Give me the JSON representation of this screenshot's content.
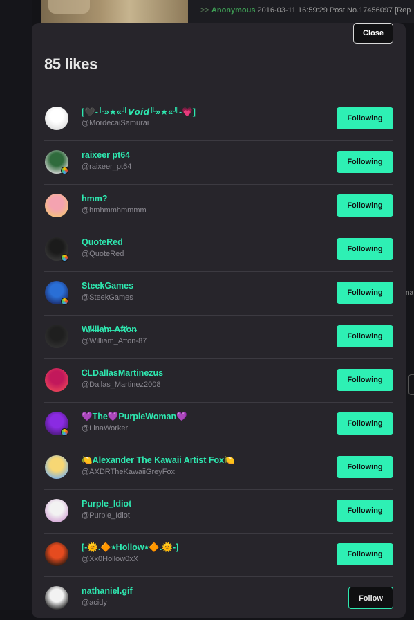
{
  "background": {
    "post_quote": ">>",
    "post_name": "Anonymous",
    "post_meta": "2016-03-11 16:59:29 Post No.17456097 [Rep"
  },
  "modal": {
    "title": "85 likes",
    "close_label": "Close"
  },
  "users": [
    {
      "name": "[🖤-╚»★«╝𝙑𝙤𝙞𝙙╚»★«╝-💗]",
      "handle": "@MordecaiSamurai",
      "button": "Following",
      "following": true,
      "avatar_colors": [
        "#ffffff",
        "#dddddd"
      ],
      "badge": false
    },
    {
      "name": "raixeer pt64",
      "handle": "@raixeer_pt64",
      "button": "Following",
      "following": true,
      "avatar_colors": [
        "#2f6b3c",
        "#d9d9d9"
      ],
      "badge": true
    },
    {
      "name": "hmm?",
      "handle": "@hmhmmhmmmm",
      "button": "Following",
      "following": true,
      "avatar_colors": [
        "#f4a3b0",
        "#f5c37a"
      ],
      "badge": false
    },
    {
      "name": "QuoteRed",
      "handle": "@QuoteRed",
      "button": "Following",
      "following": true,
      "avatar_colors": [
        "#1b1b1b",
        "#3a3a3a"
      ],
      "badge": true
    },
    {
      "name": "SteekGames",
      "handle": "@SteekGames",
      "button": "Following",
      "following": true,
      "avatar_colors": [
        "#2a6fd6",
        "#1b2b6a"
      ],
      "badge": true
    },
    {
      "name": "W̸i̷l̶l̵i̴a̸m̶ ̵A̶f̷t̸o̵n̶",
      "handle": "@William_Afton-87",
      "button": "Following",
      "following": true,
      "avatar_colors": [
        "#1f1f1f",
        "#333333"
      ],
      "badge": false
    },
    {
      "name": "ᏟᏞDallasMartinezus",
      "handle": "@Dallas_Martinez2008",
      "button": "Following",
      "following": true,
      "avatar_colors": [
        "#c2185b",
        "#e9445a"
      ],
      "badge": false
    },
    {
      "name": "💜The💜PurpleWoman💜",
      "handle": "@LinaWorker",
      "button": "Following",
      "following": true,
      "avatar_colors": [
        "#8a2be2",
        "#4b1a7a"
      ],
      "badge": true
    },
    {
      "name": "🍋Alexander The Kawaii Artist Fox🍋",
      "handle": "@AXDRTheKawaiiGreyFox",
      "button": "Following",
      "following": true,
      "avatar_colors": [
        "#f7d774",
        "#7fb3e6"
      ],
      "badge": false
    },
    {
      "name": "Purple_Idiot",
      "handle": "@Purple_Idiot",
      "button": "Following",
      "following": true,
      "avatar_colors": [
        "#f2f2f2",
        "#d4a6d6"
      ],
      "badge": false
    },
    {
      "name": "[-🌞.🔶⭒Hollow⭒🔶.🌞-]",
      "handle": "@Xx0Hollow0xX",
      "button": "Following",
      "following": true,
      "avatar_colors": [
        "#e54b1f",
        "#2a1a10"
      ],
      "badge": false
    },
    {
      "name": "nathaniel.gif",
      "handle": "@acidy",
      "button": "Follow",
      "following": false,
      "avatar_colors": [
        "#f2f2f2",
        "#222222"
      ],
      "badge": false
    }
  ],
  "colors": {
    "accent": "#2ef0b4",
    "username": "#2ee8b0",
    "modal_bg": "#27252b",
    "handle": "#8a8890"
  }
}
